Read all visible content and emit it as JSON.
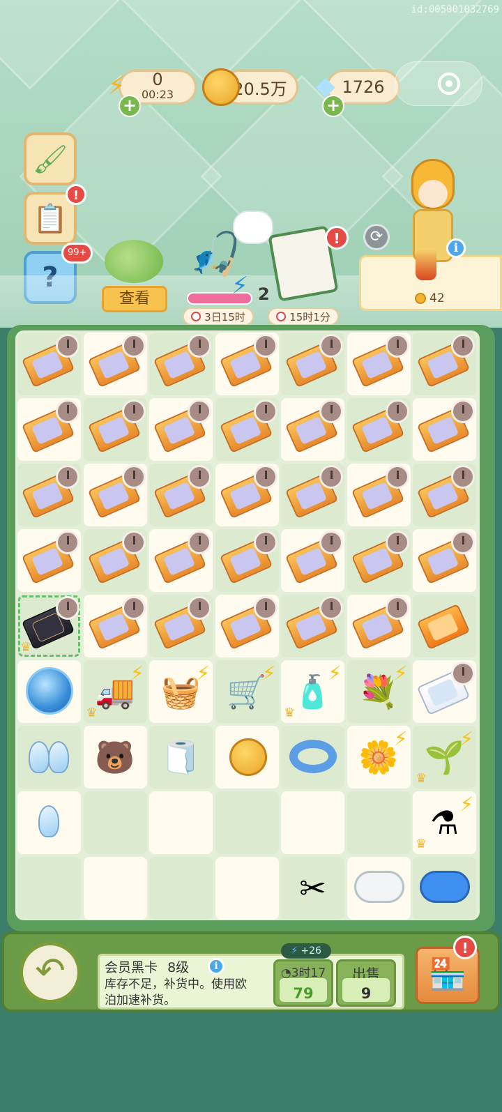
{
  "watermark": "id:005001032769",
  "resources": {
    "energy": {
      "value": "0",
      "timer": "00:23",
      "icon": "lightning-icon"
    },
    "coins": {
      "value": "20.5万",
      "icon": "coin-icon"
    },
    "gems": {
      "value": "1726",
      "icon": "diamond-icon"
    }
  },
  "side_buttons": {
    "decorate": {
      "icon": "paint-roller-icon"
    },
    "tasks": {
      "icon": "clipboard-icon",
      "badge": "!"
    },
    "mystery": {
      "icon": "question-box-icon",
      "badge": "99+"
    }
  },
  "events": {
    "dumpling": {
      "button_label": "查看",
      "icon": "green-dumpling-icon"
    },
    "fishing": {
      "energy_count": "2",
      "timer": "3日15时",
      "icon": "fishing-rod-icon"
    },
    "checklist": {
      "timer": "15时1分",
      "badge": "!",
      "icon": "checklist-icon"
    },
    "character": {
      "price": "42",
      "item_icon": "drink-icon"
    }
  },
  "board": {
    "columns": 7,
    "rows": 9,
    "row_contents": [
      [
        "ticket",
        "ticket",
        "ticket",
        "ticket",
        "ticket",
        "ticket",
        "ticket"
      ],
      [
        "ticket",
        "ticket",
        "ticket",
        "ticket",
        "ticket",
        "ticket",
        "ticket"
      ],
      [
        "ticket",
        "ticket",
        "ticket",
        "ticket",
        "ticket",
        "ticket",
        "ticket"
      ],
      [
        "ticket",
        "ticket",
        "ticket",
        "ticket",
        "ticket",
        "ticket",
        "ticket"
      ],
      [
        "black-card",
        "ticket",
        "ticket",
        "ticket",
        "ticket",
        "ticket",
        "orange-ticket"
      ],
      [
        "blue-orb",
        "ice-cream-truck",
        "beach-basket",
        "shopping-cart",
        "cleaning-supplies",
        "flower-basket",
        "white-ticket"
      ],
      [
        "crystals",
        "plush-headband",
        "folded-towel",
        "coin",
        "swim-ring",
        "flower-pot",
        "seed-bag"
      ],
      [
        "crystal",
        "empty",
        "empty",
        "empty",
        "empty",
        "empty",
        "potion-set"
      ],
      [
        "empty",
        "empty",
        "empty",
        "empty",
        "scissors",
        "white-soap",
        "blue-soap"
      ]
    ]
  },
  "selected_item": {
    "name": "会员黑卡",
    "level": "8级",
    "description": "库存不足，补货中。使用欧泊加速补货。",
    "energy_boost": "+26",
    "speedup_timer": "3时17分",
    "speedup_cost": "79",
    "sell_label": "出售",
    "sell_price": "9"
  },
  "colors": {
    "board_green": "#5a9d5c",
    "panel_green": "#6a9c47",
    "accent_orange": "#e88a2c",
    "alert_red": "#e54a45"
  }
}
